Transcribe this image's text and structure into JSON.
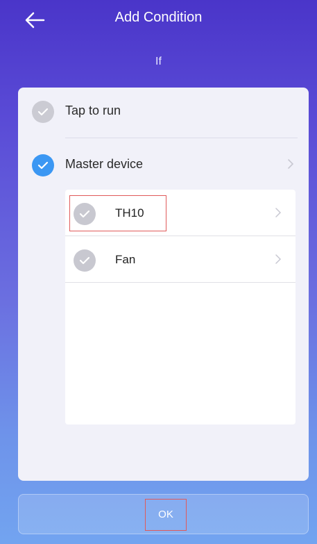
{
  "header": {
    "title": "Add Condition"
  },
  "subheading": "If",
  "options": [
    {
      "label": "Tap to run",
      "selected": false
    },
    {
      "label": "Master device",
      "selected": true
    }
  ],
  "devices": [
    {
      "label": "TH10"
    },
    {
      "label": "Fan"
    }
  ],
  "footer": {
    "ok_label": "OK"
  },
  "colors": {
    "accent": "#3b97f3",
    "unselected": "#cbcbd3",
    "highlight_box": "#e05a5a"
  }
}
